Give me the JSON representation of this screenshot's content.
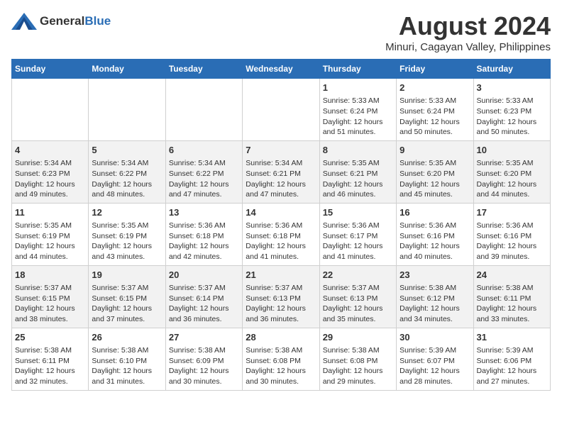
{
  "header": {
    "logo_general": "General",
    "logo_blue": "Blue",
    "title": "August 2024",
    "subtitle": "Minuri, Cagayan Valley, Philippines"
  },
  "weekdays": [
    "Sunday",
    "Monday",
    "Tuesday",
    "Wednesday",
    "Thursday",
    "Friday",
    "Saturday"
  ],
  "weeks": [
    [
      {
        "day": "",
        "sunrise": "",
        "sunset": "",
        "daylight": ""
      },
      {
        "day": "",
        "sunrise": "",
        "sunset": "",
        "daylight": ""
      },
      {
        "day": "",
        "sunrise": "",
        "sunset": "",
        "daylight": ""
      },
      {
        "day": "",
        "sunrise": "",
        "sunset": "",
        "daylight": ""
      },
      {
        "day": "1",
        "sunrise": "Sunrise: 5:33 AM",
        "sunset": "Sunset: 6:24 PM",
        "daylight": "Daylight: 12 hours and 51 minutes."
      },
      {
        "day": "2",
        "sunrise": "Sunrise: 5:33 AM",
        "sunset": "Sunset: 6:24 PM",
        "daylight": "Daylight: 12 hours and 50 minutes."
      },
      {
        "day": "3",
        "sunrise": "Sunrise: 5:33 AM",
        "sunset": "Sunset: 6:23 PM",
        "daylight": "Daylight: 12 hours and 50 minutes."
      }
    ],
    [
      {
        "day": "4",
        "sunrise": "Sunrise: 5:34 AM",
        "sunset": "Sunset: 6:23 PM",
        "daylight": "Daylight: 12 hours and 49 minutes."
      },
      {
        "day": "5",
        "sunrise": "Sunrise: 5:34 AM",
        "sunset": "Sunset: 6:22 PM",
        "daylight": "Daylight: 12 hours and 48 minutes."
      },
      {
        "day": "6",
        "sunrise": "Sunrise: 5:34 AM",
        "sunset": "Sunset: 6:22 PM",
        "daylight": "Daylight: 12 hours and 47 minutes."
      },
      {
        "day": "7",
        "sunrise": "Sunrise: 5:34 AM",
        "sunset": "Sunset: 6:21 PM",
        "daylight": "Daylight: 12 hours and 47 minutes."
      },
      {
        "day": "8",
        "sunrise": "Sunrise: 5:35 AM",
        "sunset": "Sunset: 6:21 PM",
        "daylight": "Daylight: 12 hours and 46 minutes."
      },
      {
        "day": "9",
        "sunrise": "Sunrise: 5:35 AM",
        "sunset": "Sunset: 6:20 PM",
        "daylight": "Daylight: 12 hours and 45 minutes."
      },
      {
        "day": "10",
        "sunrise": "Sunrise: 5:35 AM",
        "sunset": "Sunset: 6:20 PM",
        "daylight": "Daylight: 12 hours and 44 minutes."
      }
    ],
    [
      {
        "day": "11",
        "sunrise": "Sunrise: 5:35 AM",
        "sunset": "Sunset: 6:19 PM",
        "daylight": "Daylight: 12 hours and 44 minutes."
      },
      {
        "day": "12",
        "sunrise": "Sunrise: 5:35 AM",
        "sunset": "Sunset: 6:19 PM",
        "daylight": "Daylight: 12 hours and 43 minutes."
      },
      {
        "day": "13",
        "sunrise": "Sunrise: 5:36 AM",
        "sunset": "Sunset: 6:18 PM",
        "daylight": "Daylight: 12 hours and 42 minutes."
      },
      {
        "day": "14",
        "sunrise": "Sunrise: 5:36 AM",
        "sunset": "Sunset: 6:18 PM",
        "daylight": "Daylight: 12 hours and 41 minutes."
      },
      {
        "day": "15",
        "sunrise": "Sunrise: 5:36 AM",
        "sunset": "Sunset: 6:17 PM",
        "daylight": "Daylight: 12 hours and 41 minutes."
      },
      {
        "day": "16",
        "sunrise": "Sunrise: 5:36 AM",
        "sunset": "Sunset: 6:16 PM",
        "daylight": "Daylight: 12 hours and 40 minutes."
      },
      {
        "day": "17",
        "sunrise": "Sunrise: 5:36 AM",
        "sunset": "Sunset: 6:16 PM",
        "daylight": "Daylight: 12 hours and 39 minutes."
      }
    ],
    [
      {
        "day": "18",
        "sunrise": "Sunrise: 5:37 AM",
        "sunset": "Sunset: 6:15 PM",
        "daylight": "Daylight: 12 hours and 38 minutes."
      },
      {
        "day": "19",
        "sunrise": "Sunrise: 5:37 AM",
        "sunset": "Sunset: 6:15 PM",
        "daylight": "Daylight: 12 hours and 37 minutes."
      },
      {
        "day": "20",
        "sunrise": "Sunrise: 5:37 AM",
        "sunset": "Sunset: 6:14 PM",
        "daylight": "Daylight: 12 hours and 36 minutes."
      },
      {
        "day": "21",
        "sunrise": "Sunrise: 5:37 AM",
        "sunset": "Sunset: 6:13 PM",
        "daylight": "Daylight: 12 hours and 36 minutes."
      },
      {
        "day": "22",
        "sunrise": "Sunrise: 5:37 AM",
        "sunset": "Sunset: 6:13 PM",
        "daylight": "Daylight: 12 hours and 35 minutes."
      },
      {
        "day": "23",
        "sunrise": "Sunrise: 5:38 AM",
        "sunset": "Sunset: 6:12 PM",
        "daylight": "Daylight: 12 hours and 34 minutes."
      },
      {
        "day": "24",
        "sunrise": "Sunrise: 5:38 AM",
        "sunset": "Sunset: 6:11 PM",
        "daylight": "Daylight: 12 hours and 33 minutes."
      }
    ],
    [
      {
        "day": "25",
        "sunrise": "Sunrise: 5:38 AM",
        "sunset": "Sunset: 6:11 PM",
        "daylight": "Daylight: 12 hours and 32 minutes."
      },
      {
        "day": "26",
        "sunrise": "Sunrise: 5:38 AM",
        "sunset": "Sunset: 6:10 PM",
        "daylight": "Daylight: 12 hours and 31 minutes."
      },
      {
        "day": "27",
        "sunrise": "Sunrise: 5:38 AM",
        "sunset": "Sunset: 6:09 PM",
        "daylight": "Daylight: 12 hours and 30 minutes."
      },
      {
        "day": "28",
        "sunrise": "Sunrise: 5:38 AM",
        "sunset": "Sunset: 6:08 PM",
        "daylight": "Daylight: 12 hours and 30 minutes."
      },
      {
        "day": "29",
        "sunrise": "Sunrise: 5:38 AM",
        "sunset": "Sunset: 6:08 PM",
        "daylight": "Daylight: 12 hours and 29 minutes."
      },
      {
        "day": "30",
        "sunrise": "Sunrise: 5:39 AM",
        "sunset": "Sunset: 6:07 PM",
        "daylight": "Daylight: 12 hours and 28 minutes."
      },
      {
        "day": "31",
        "sunrise": "Sunrise: 5:39 AM",
        "sunset": "Sunset: 6:06 PM",
        "daylight": "Daylight: 12 hours and 27 minutes."
      }
    ]
  ]
}
